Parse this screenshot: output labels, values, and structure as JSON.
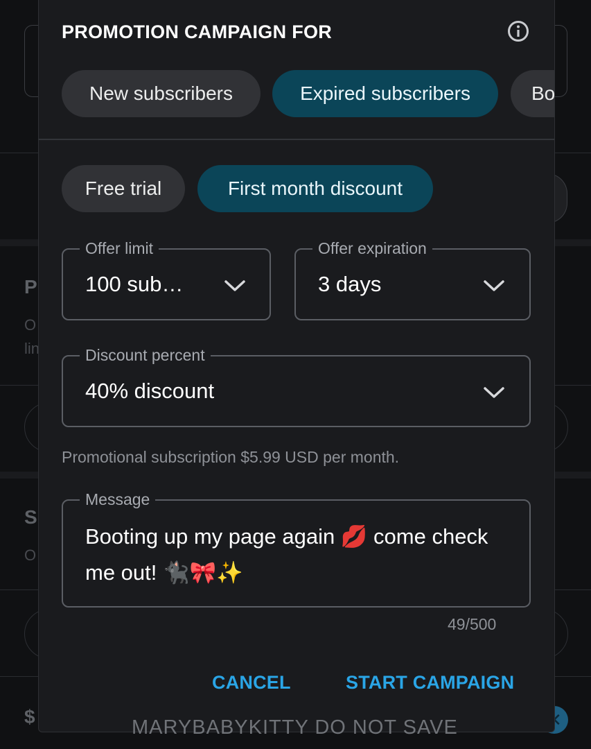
{
  "background": {
    "ghost_letters": [
      "P",
      "O",
      "lin",
      "S",
      "O",
      "$"
    ]
  },
  "dialog": {
    "title": "PROMOTION CAMPAIGN FOR",
    "info_icon": "info-icon",
    "audience_chips": [
      {
        "label": "New subscribers",
        "selected": false
      },
      {
        "label": "Expired subscribers",
        "selected": true
      },
      {
        "label": "Bo",
        "selected": false
      }
    ],
    "offer_type_chips": [
      {
        "label": "Free trial",
        "selected": false
      },
      {
        "label": "First month discount",
        "selected": true
      }
    ],
    "offer_limit": {
      "label": "Offer limit",
      "value": "100 sub…"
    },
    "offer_expiration": {
      "label": "Offer expiration",
      "value": "3 days"
    },
    "discount_percent": {
      "label": "Discount percent",
      "value": "40% discount"
    },
    "helper_text": "Promotional subscription $5.99 USD per month.",
    "message": {
      "label": "Message",
      "value": "Booting up my page again 💋 come check me out! 🐈‍⬛🎀✨",
      "counter": "49/500"
    },
    "cancel_label": "CANCEL",
    "start_label": "START CAMPAIGN"
  },
  "watermark": "MARYBABYKITTY DO NOT SAVE",
  "colors": {
    "accent": "#2aa5e6",
    "chip_selected": "#0b4558",
    "chip_unselected": "#313236",
    "dialog_bg": "#1a1b1e"
  }
}
